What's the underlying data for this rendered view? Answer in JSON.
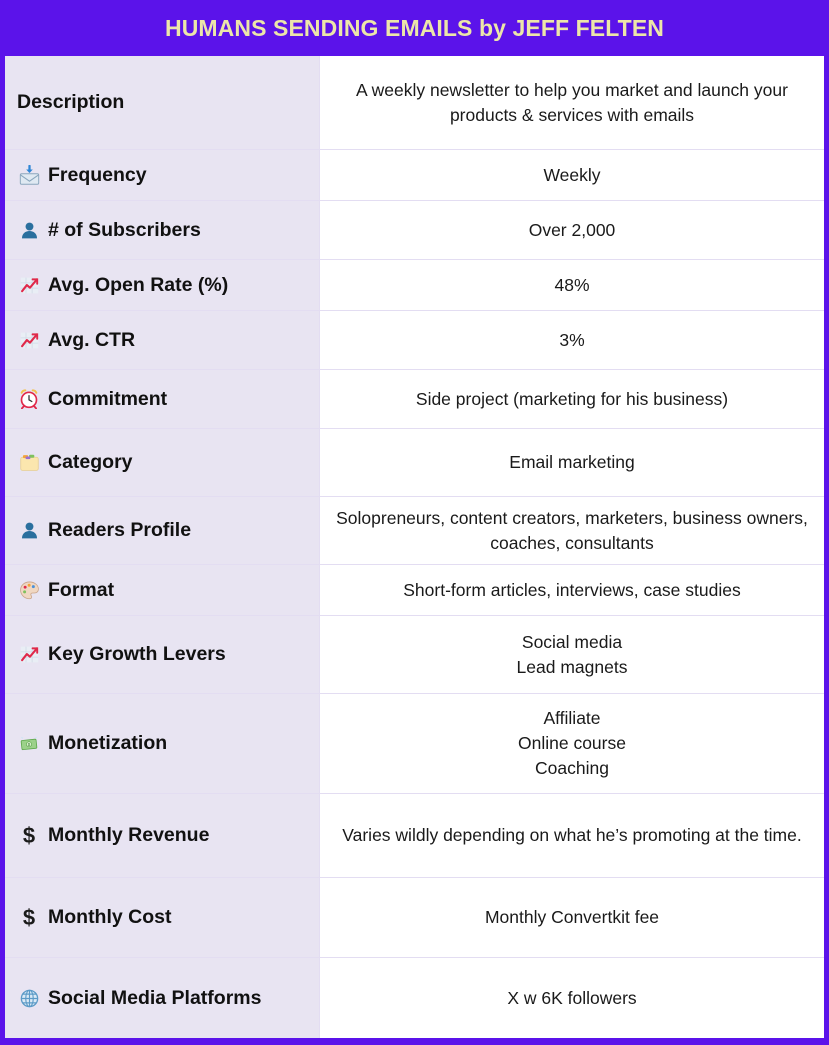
{
  "header": {
    "title": "HUMANS SENDING EMAILS by JEFF FELTEN",
    "background_color": "#5B13EA",
    "title_color": "#ECE6A9"
  },
  "theme": {
    "accent": "#5B13EA",
    "label_column_background": "#E8E4F2",
    "value_column_background": "#FFFFFF",
    "row_divider": "#E3DDF2"
  },
  "table": {
    "rows": [
      {
        "icon": "none",
        "label": "Description",
        "value": "A weekly newsletter to help you market and launch your products & services with emails"
      },
      {
        "icon": "incoming-envelope-icon",
        "label": "Frequency",
        "value": "Weekly"
      },
      {
        "icon": "bust-in-silhouette-icon",
        "label": "# of Subscribers",
        "value": "Over 2,000"
      },
      {
        "icon": "chart-increasing-icon",
        "label": "Avg. Open Rate (%)",
        "value": "48%"
      },
      {
        "icon": "chart-increasing-icon",
        "label": "Avg. CTR",
        "value": "3%"
      },
      {
        "icon": "alarm-clock-icon",
        "label": "Commitment",
        "value": "Side project (marketing for his business)"
      },
      {
        "icon": "card-index-dividers-icon",
        "label": "Category",
        "value": "Email marketing"
      },
      {
        "icon": "bust-in-silhouette-icon",
        "label": "Readers Profile",
        "value": "Solopreneurs, content creators, marketers, business owners, coaches, consultants"
      },
      {
        "icon": "artist-palette-icon",
        "label": "Format",
        "value": "Short-form articles, interviews, case studies"
      },
      {
        "icon": "chart-increasing-icon",
        "label": "Key Growth Levers",
        "value": "Social media\nLead magnets"
      },
      {
        "icon": "money-with-wings-icon",
        "label": "Monetization",
        "value": "Affiliate\nOnline course\nCoaching"
      },
      {
        "icon": "dollar-sign-icon",
        "label": "Monthly Revenue",
        "value": "Varies wildly depending on what he’s promoting at the time."
      },
      {
        "icon": "dollar-sign-icon",
        "label": "Monthly Cost",
        "value": "Monthly Convertkit fee"
      },
      {
        "icon": "globe-with-meridians-icon",
        "label": "Social Media Platforms",
        "value": "X w 6K followers"
      }
    ]
  }
}
